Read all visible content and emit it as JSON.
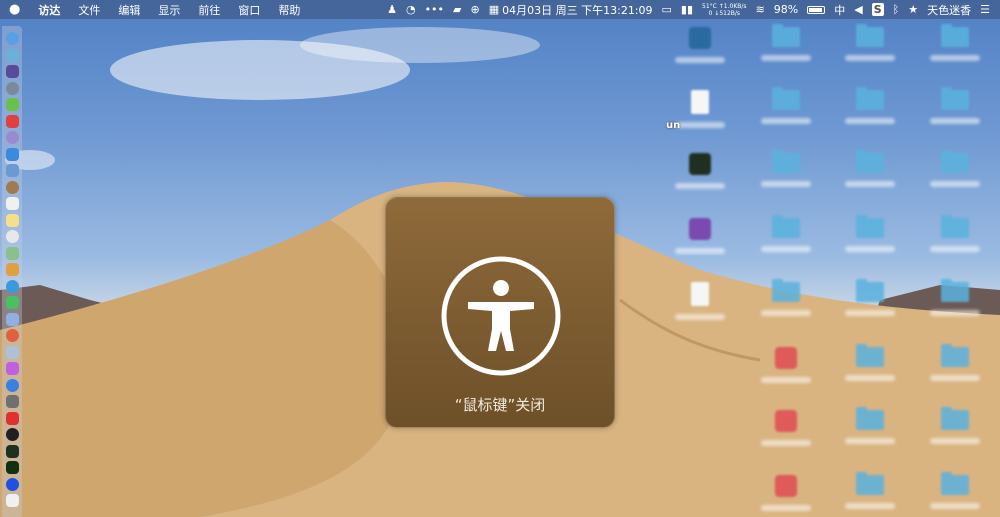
{
  "menubar": {
    "apple": "",
    "menus": [
      "访达",
      "文件",
      "编辑",
      "显示",
      "前往",
      "窗口",
      "帮助"
    ],
    "datetime": "04月03日 周三 下午13:21:09",
    "temp": "51°C",
    "net_up": "↑1.0KB/s",
    "net_zero": "0",
    "net_down": "↓512B/s",
    "battery": "98%",
    "input_method": "中",
    "user": "天色迷香"
  },
  "desktop": {
    "partial_label": "un"
  },
  "hud": {
    "message": "“鼠标键”关闭",
    "icon": "accessibility-icon"
  }
}
